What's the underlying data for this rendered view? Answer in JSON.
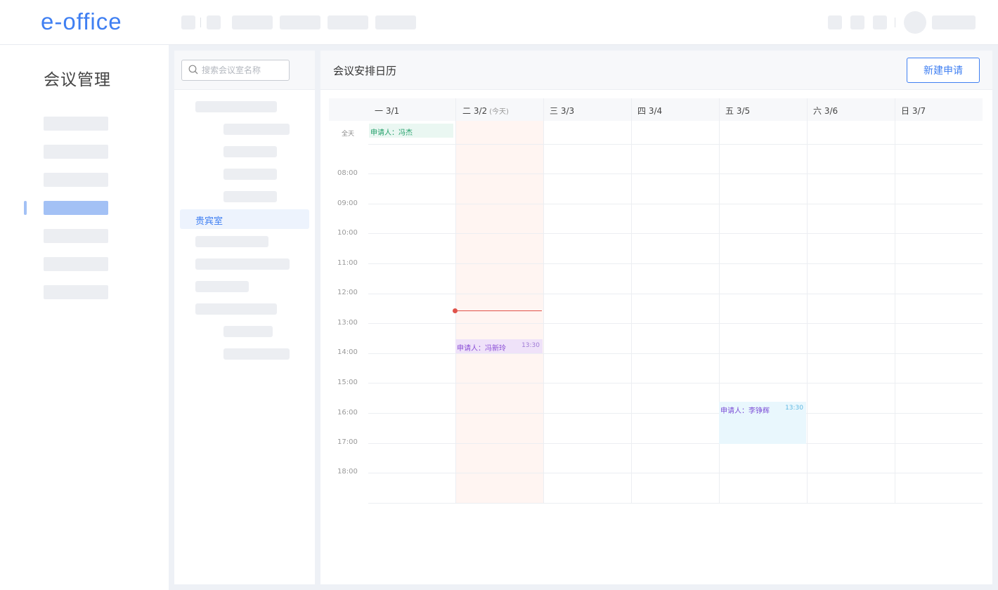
{
  "app": {
    "logo": "e-office"
  },
  "sidebar": {
    "title": "会议管理"
  },
  "rooms": {
    "search_placeholder": "搜索会议室名称",
    "selected_room": "贵宾室"
  },
  "calendar": {
    "title": "会议安排日历",
    "new_button": "新建申请",
    "allday_label": "全天",
    "today_tag": "(今天)",
    "days": [
      {
        "label": "一 3/1"
      },
      {
        "label": "二 3/2"
      },
      {
        "label": "三 3/3"
      },
      {
        "label": "四 3/4"
      },
      {
        "label": "五 3/5"
      },
      {
        "label": "六 3/6"
      },
      {
        "label": "日 3/7"
      }
    ],
    "times": [
      "08:00",
      "09:00",
      "10:00",
      "11:00",
      "12:00",
      "13:00",
      "14:00",
      "15:00",
      "16:00",
      "17:00",
      "18:00"
    ],
    "events": {
      "allday": {
        "who": "申请人：冯杰"
      },
      "tue": {
        "who": "申请人：冯新玲",
        "time": "13:30"
      },
      "fri": {
        "who": "申请人：李铮辉",
        "time": "13:30"
      }
    }
  },
  "colors": {
    "accent": "#3f7ff2",
    "now_line": "#e0524a"
  }
}
